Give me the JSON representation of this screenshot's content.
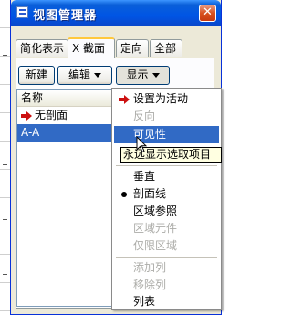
{
  "window": {
    "title": "视图管理器",
    "close_glyph": "✕"
  },
  "tabs": [
    {
      "label": "简化表示"
    },
    {
      "label": "X 截面"
    },
    {
      "label": "定向"
    },
    {
      "label": "全部"
    }
  ],
  "toolbar": {
    "new_label": "新建",
    "edit_label": "编辑",
    "display_label": "显示"
  },
  "list": {
    "header": "名称",
    "rows": [
      {
        "label": "无剖面",
        "icon": "red-arrow-icon"
      },
      {
        "label": "A-A",
        "selected": true
      }
    ]
  },
  "menu": {
    "items": [
      {
        "label": "设置为活动",
        "icon": "red-arrow-icon",
        "enabled": true
      },
      {
        "label": "反向",
        "enabled": false
      },
      {
        "label": "可见性",
        "enabled": true,
        "highlighted": true
      },
      {
        "label": "垂直",
        "enabled": true
      },
      {
        "label": "剖面线",
        "enabled": true,
        "checked": true
      },
      {
        "label": "区域参照",
        "enabled": true
      },
      {
        "label": "区域元件",
        "enabled": false
      },
      {
        "label": "仅限区域",
        "enabled": false
      },
      {
        "label": "添加列",
        "enabled": false
      },
      {
        "label": "移除列",
        "enabled": false
      },
      {
        "label": "列表",
        "enabled": true
      }
    ]
  },
  "tooltip": {
    "text": "永远显示选取项目"
  },
  "colors": {
    "selection": "#316ac5",
    "title_blue": "#0055e5",
    "active_tab_accent": "#ffc83c",
    "arrow_red": "#cc1010",
    "close_red": "#d8501e"
  }
}
